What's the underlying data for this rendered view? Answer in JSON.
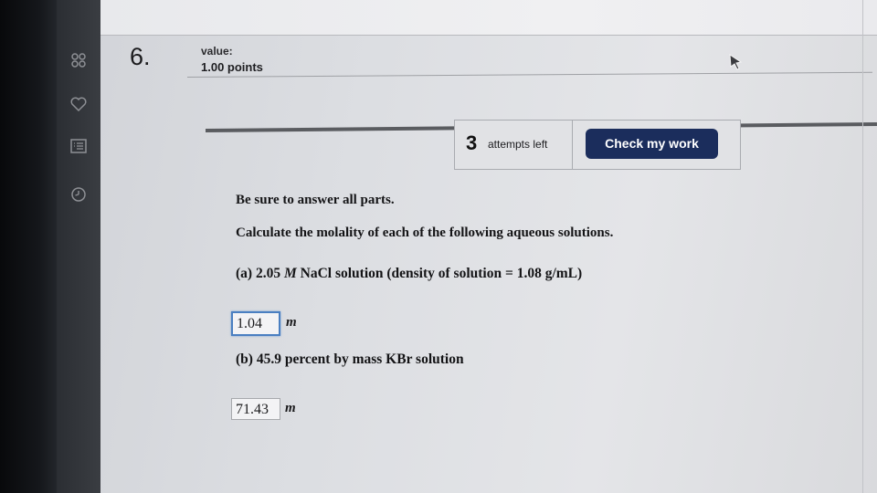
{
  "question": {
    "number": "6.",
    "value_label": "value:",
    "points": "1.00 points"
  },
  "actions": {
    "attempts_count": "3",
    "attempts_text": "attempts left",
    "check_label": "Check my work"
  },
  "content": {
    "instruction": "Be sure to answer all parts.",
    "prompt": "Calculate the molality of each of the following aqueous solutions.",
    "part_a": {
      "label": "(a) 2.05 ",
      "italic": "M",
      "rest": " NaCl solution (density of solution = 1.08 g/mL)",
      "answer": "1.04",
      "unit": "m"
    },
    "part_b": {
      "label": "(b) 45.9 percent by mass KBr solution",
      "answer": "71.43",
      "unit": "m"
    }
  },
  "sidebar": {
    "icons": [
      "grid-icon",
      "heart-icon",
      "list-icon",
      "clock-icon"
    ]
  },
  "colors": {
    "check_button": "#1b2d5c",
    "active_input_border": "#4a7fc1"
  }
}
